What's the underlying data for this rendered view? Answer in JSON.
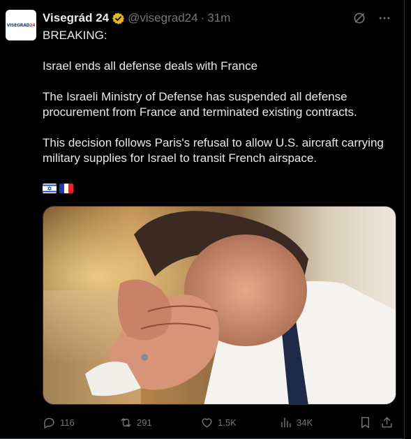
{
  "author": {
    "avatar_text_1": "VISEGRAD",
    "avatar_text_2": "24",
    "name": "Visegrád 24",
    "handle": "@visegrad24",
    "separator": "·",
    "time": "31m"
  },
  "post": {
    "line1": "BREAKING:",
    "line2": "Israel ends all defense deals with France",
    "line3": "The Israeli Ministry of Defense has suspended all defense procurement from France and terminated existing contracts.",
    "line4": "This decision follows Paris's refusal to allow U.S. aircraft carrying military supplies for Israel to transit French airspace."
  },
  "flags": [
    "israel-flag",
    "france-flag"
  ],
  "media": {
    "kind": "photo"
  },
  "actions": {
    "replies": "116",
    "reposts": "291",
    "likes": "1.5K",
    "views": "34K"
  },
  "colors": {
    "background": "#000000",
    "text": "#e7e9ea",
    "muted": "#71767b",
    "verified": "#e2b719"
  }
}
